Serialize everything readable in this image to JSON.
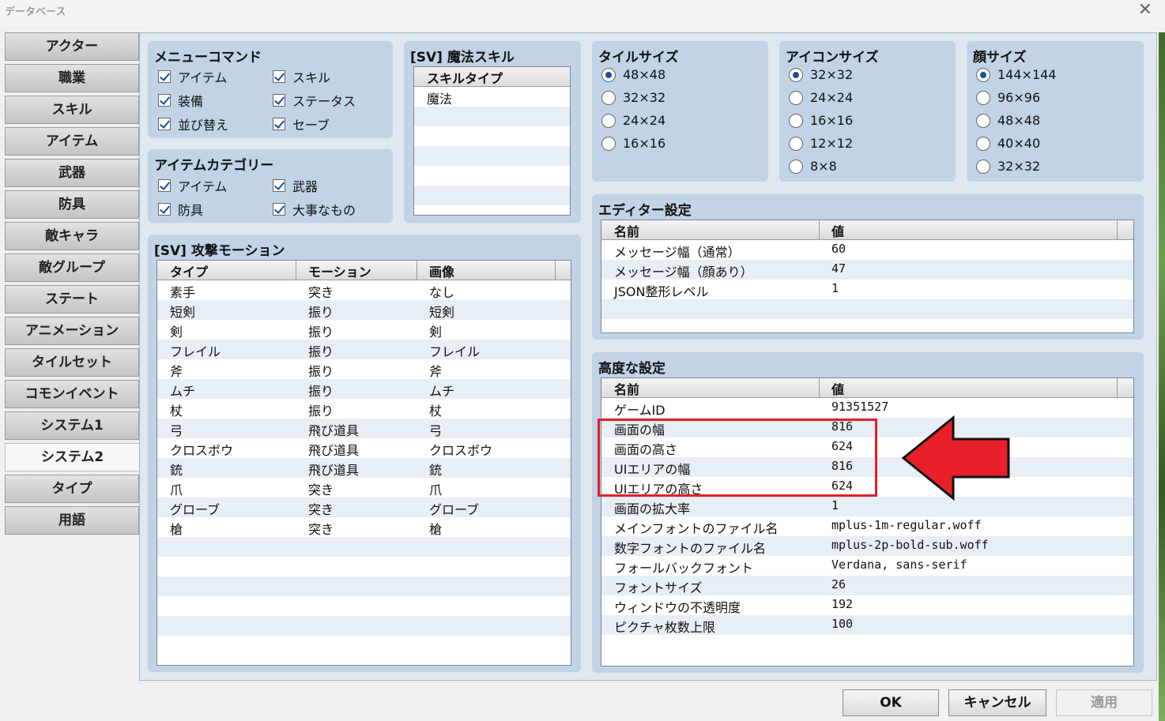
{
  "window": {
    "title": "データベース"
  },
  "sidebar": {
    "items": [
      "アクター",
      "職業",
      "スキル",
      "アイテム",
      "武器",
      "防具",
      "敵キャラ",
      "敵グループ",
      "ステート",
      "アニメーション",
      "タイルセット",
      "コモンイベント",
      "システム1",
      "システム2",
      "タイプ",
      "用語"
    ],
    "active_index": 13
  },
  "menu_commands": {
    "title": "メニューコマンド",
    "items": [
      {
        "label": "アイテム",
        "checked": true
      },
      {
        "label": "スキル",
        "checked": true
      },
      {
        "label": "装備",
        "checked": true
      },
      {
        "label": "ステータス",
        "checked": true
      },
      {
        "label": "並び替え",
        "checked": true
      },
      {
        "label": "セーブ",
        "checked": true
      }
    ]
  },
  "item_categories": {
    "title": "アイテムカテゴリー",
    "items": [
      {
        "label": "アイテム",
        "checked": true
      },
      {
        "label": "武器",
        "checked": true
      },
      {
        "label": "防具",
        "checked": true
      },
      {
        "label": "大事なもの",
        "checked": true
      }
    ]
  },
  "sv_magic": {
    "title": "[SV] 魔法スキル",
    "header": "スキルタイプ",
    "rows": [
      "魔法"
    ]
  },
  "attack_motion": {
    "title": "[SV] 攻撃モーション",
    "headers": [
      "タイプ",
      "モーション",
      "画像"
    ],
    "rows": [
      [
        "素手",
        "突き",
        "なし"
      ],
      [
        "短剣",
        "振り",
        "短剣"
      ],
      [
        "剣",
        "振り",
        "剣"
      ],
      [
        "フレイル",
        "振り",
        "フレイル"
      ],
      [
        "斧",
        "振り",
        "斧"
      ],
      [
        "ムチ",
        "振り",
        "ムチ"
      ],
      [
        "杖",
        "振り",
        "杖"
      ],
      [
        "弓",
        "飛び道具",
        "弓"
      ],
      [
        "クロスボウ",
        "飛び道具",
        "クロスボウ"
      ],
      [
        "銃",
        "飛び道具",
        "銃"
      ],
      [
        "爪",
        "突き",
        "爪"
      ],
      [
        "グローブ",
        "突き",
        "グローブ"
      ],
      [
        "槍",
        "突き",
        "槍"
      ]
    ]
  },
  "tile_size": {
    "title": "タイルサイズ",
    "options": [
      "48×48",
      "32×32",
      "24×24",
      "16×16"
    ],
    "selected": 0
  },
  "icon_size": {
    "title": "アイコンサイズ",
    "options": [
      "32×32",
      "24×24",
      "16×16",
      "12×12",
      "8×8"
    ],
    "selected": 0
  },
  "face_size": {
    "title": "顔サイズ",
    "options": [
      "144×144",
      "96×96",
      "48×48",
      "40×40",
      "32×32"
    ],
    "selected": 0
  },
  "editor_settings": {
    "title": "エディター設定",
    "headers": [
      "名前",
      "値"
    ],
    "rows": [
      [
        "メッセージ幅（通常）",
        "60"
      ],
      [
        "メッセージ幅（顔あり）",
        "47"
      ],
      [
        "JSON整形レベル",
        "1"
      ]
    ]
  },
  "advanced_settings": {
    "title": "高度な設定",
    "headers": [
      "名前",
      "値"
    ],
    "rows": [
      [
        "ゲームID",
        "91351527"
      ],
      [
        "画面の幅",
        "816"
      ],
      [
        "画面の高さ",
        "624"
      ],
      [
        "UIエリアの幅",
        "816"
      ],
      [
        "UIエリアの高さ",
        "624"
      ],
      [
        "画面の拡大率",
        "1"
      ],
      [
        "メインフォントのファイル名",
        "mplus-1m-regular.woff"
      ],
      [
        "数字フォントのファイル名",
        "mplus-2p-bold-sub.woff"
      ],
      [
        "フォールバックフォント",
        "Verdana, sans-serif"
      ],
      [
        "フォントサイズ",
        "26"
      ],
      [
        "ウィンドウの不透明度",
        "192"
      ],
      [
        "ピクチャ枚数上限",
        "100"
      ]
    ]
  },
  "buttons": {
    "ok": "OK",
    "cancel": "キャンセル",
    "apply": "適用"
  },
  "colors": {
    "highlight_box": "#e0202a",
    "arrow": "#e8202a"
  }
}
